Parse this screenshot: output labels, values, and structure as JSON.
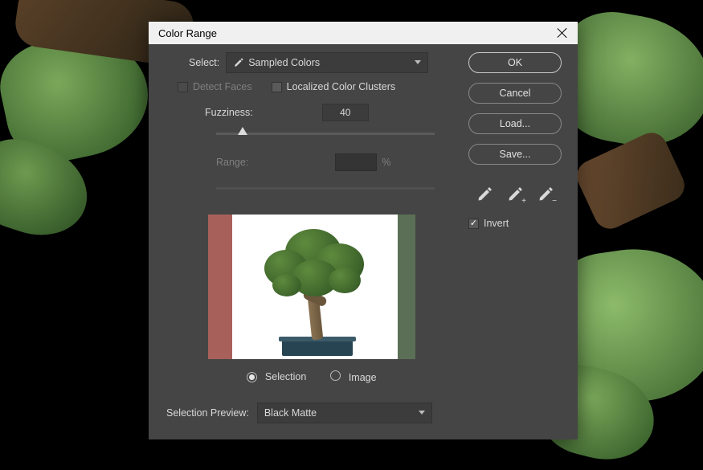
{
  "dialog": {
    "title": "Color Range",
    "select_label": "Select:",
    "select_value": "Sampled Colors",
    "detect_faces_label": "Detect Faces",
    "detect_faces_checked": false,
    "localized_label": "Localized Color Clusters",
    "localized_checked": false,
    "fuzziness_label": "Fuzziness:",
    "fuzziness_value": "40",
    "fuzziness_slider_pct": 12,
    "range_label": "Range:",
    "range_value": "",
    "range_unit": "%",
    "radio_selection_label": "Selection",
    "radio_image_label": "Image",
    "radio_value": "selection",
    "selection_preview_label": "Selection Preview:",
    "selection_preview_value": "Black Matte"
  },
  "buttons": {
    "ok": "OK",
    "cancel": "Cancel",
    "load": "Load...",
    "save": "Save..."
  },
  "eyedroppers": {
    "sample": "eyedropper",
    "add": "eyedropper-plus",
    "subtract": "eyedropper-minus"
  },
  "invert": {
    "label": "Invert",
    "checked": true
  },
  "icons": {
    "close": "close-icon",
    "chevron": "chevron-down-icon",
    "eyedropper_small": "eyedropper-icon"
  },
  "colors": {
    "dialog_bg": "#454545",
    "titlebar_bg": "#f0f0f0",
    "text": "#d8d8d8",
    "disabled_text": "#7f7f7f",
    "button_border": "#888888",
    "preview_stripe_left": "#a8615a",
    "preview_stripe_right": "#5b6f56",
    "pot": "#274452",
    "foliage_light": "#5e8a3d",
    "foliage_dark": "#2e5222"
  }
}
